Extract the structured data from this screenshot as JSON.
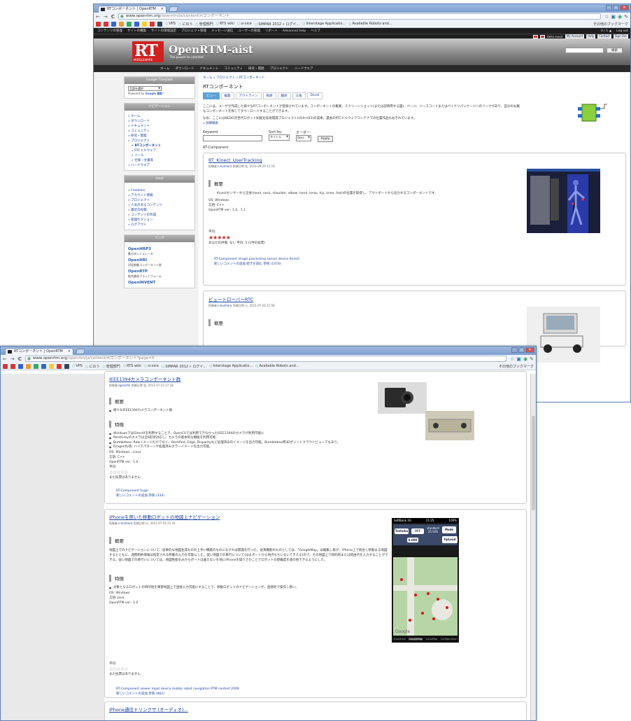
{
  "window1": {
    "tab_title": "RTコンポーネント | OpenRTM",
    "tab_close": "×",
    "controls": [
      "–",
      "▫",
      "✕"
    ],
    "url_host": "www.openrtm.org",
    "url_path": "/openrtm/ja/content/rtコンポーネント",
    "nav_back": "←",
    "nav_forward": "→",
    "nav_reload": "C",
    "bookmarks": [
      "VPS",
      "にのう",
      "管理部門",
      "RTS wiki",
      "si-sice",
      "SIMPAR 2012 » ログイ...",
      "Interstage Applicatio...",
      "Available Robots and..."
    ],
    "bookmarks_other": "その他のブックマーク",
    "admin_menu": [
      "コンテンツの管理",
      "サイトの構築",
      "サイトの環境設定",
      "プロジェクト管理",
      "メッセージ送信",
      "ユーザーの管理",
      "リポート",
      "Advanced help",
      "ヘルプ"
    ],
    "admin_count": "0 / 1 ▲",
    "admin_logout": "Log out",
    "user_links": [
      "Hello mostr",
      "My Account",
      "Help",
      "Contact",
      "Sign Out"
    ],
    "site_title": "OpenRTM-aist",
    "site_subtitle": "The power to connect",
    "logo_text": "RT",
    "logo_sub": "MIDDLEWARE",
    "search_button": "検索",
    "nav_items": [
      "ホーム",
      "ダウンロード",
      "ドキュメント",
      "コミュニティ",
      "研究・開発",
      "プロジェクト",
      "ハードウエア"
    ],
    "sidebar": {
      "translate_title": "Google Translate",
      "translate_select": "言語を選択",
      "powered_by": "Powered by",
      "powered_brand": "Google 翻訳",
      "nav_title": "ナビゲーション",
      "nav_links": [
        "» ホーム",
        "» ダウンロード",
        "» ドキュメント",
        "» コミュニティ",
        "» 研究・開発",
        "» プロジェクト",
        "» RTコンポーネント",
        "» RTCドルウェア",
        "» ツール",
        "» 仕様・文書等",
        "» ハードウエア"
      ],
      "user_title": "most",
      "user_links": [
        "» Freelinks",
        "» アカウント情報",
        "» プロジェクト",
        "» 人気のあるコンテンツ",
        "» 最近の投稿",
        "» コンテンツの作成",
        "» 管理セクション",
        "» ログアウト"
      ],
      "links_title": "リンク",
      "ext_links": [
        {
          "name": "OpenHRP3",
          "desc": "動力学シミュレータ"
        },
        {
          "name": "OpenHRI",
          "desc": "対話制御コンポーネント群"
        },
        {
          "name": "OpenRTP",
          "desc": "統合開発プラットフォーム"
        },
        {
          "name": "OpenINVENT",
          "desc": ""
        }
      ]
    },
    "breadcrumb": "ホーム » プロジェクト » RTコンポーネント",
    "page_title": "RTコンポーネント",
    "page_tabs": [
      "ビュー",
      "編集",
      "アウトライン",
      "軌跡",
      "翻訳",
      "三角",
      "Devel"
    ],
    "desc1": "ここには、ユーザが作成した様々なRTコンポーネントが登録されています。コンポーネントの概要、スクリーンショット(または説明用する図)、ページ、ソースコードまたはバイナリパッケージへのリンクがあり、自分のお菓なコンポーネントを探してダウンロードすることができます。",
    "desc2": "なお、ここにはNEDO次世代ロボット知能化技術開発プロジェクト(H19-H23)の成果、還会のRTCドルウェアコンテナ下の位置作品もおきれています。",
    "more_link": "» 詳細検索",
    "filter": {
      "keyword_label": "Keyword",
      "sort_label": "Sort by:",
      "sort_value": "タイトル",
      "order_label": "オーダー:",
      "order_value": "Desc",
      "apply": "Apply"
    },
    "list_label": "RT-Component",
    "card1": {
      "title": "RT_Kinect_UserTracking",
      "meta_prefix": "投稿者:",
      "author": "s-kurihara",
      "meta_suffix": "投稿日時:金, 2011-09-29 11:19",
      "section": "概要",
      "body": "Kinectセンサーから全身(head, neck, shoulder, elbow, hand, torso, hip, knee, foot)の位置を取得し、アウトポートから出力するコンポーネントです。",
      "os": "OS: Windows",
      "lang": "言語: C++",
      "ver": "OpenRTM ver.: 1.0、1.1",
      "rating_label": "平均:",
      "stars": "★★★★★",
      "rating_text": "あなたの評価: なし 平均: 5 (1件の投票)",
      "tags": "RT-Component  image processing  sensor device  Kinect",
      "links": "新しいコメントの追加  続きを読む  参照 (1474)"
    },
    "card2": {
      "title": "ビュートローバーRTC",
      "meta_prefix": "投稿者:",
      "author": "s-kurihara",
      "meta_suffix": "投稿日時:火, 2011-07-26 21:58",
      "section": "概要"
    }
  },
  "window2": {
    "tab_title": "RTコンポーネント | OpenRTM",
    "tab_close": "×",
    "controls": [
      "–",
      "▫",
      "✕"
    ],
    "url_host": "www.openrtm.org",
    "url_path": "/openrtm/ja/content/rtコンポーネント?page=5",
    "nav_back": "←",
    "nav_forward": "→",
    "nav_reload": "C",
    "bookmarks": [
      "VPS",
      "にのう",
      "管理部門",
      "RTS wiki",
      "si-sice",
      "SIMPAR 2012 » ログイ...",
      "Interstage Applicatio...",
      "Available Robots and..."
    ],
    "bookmarks_other": "その他のブックマーク",
    "cardA": {
      "title": "IEEE1394カメラコンポーネント群",
      "meta_prefix": "投稿者:",
      "author": "openrtm",
      "meta_suffix": "投稿日時:金, 2011-07-15 17:18",
      "overview": "概要",
      "overview_items": [
        "様々なIEEE1394カメラコンポーネント群"
      ],
      "features": "特徴",
      "feature_items": [
        "WindowsではDirectXを利用することで、OpenCVでは利用できなかったIEEE1394のカメラが利用可能に",
        "PointGreyのカメラは全6形状対応し、カメラの基本的な機能を利用可能",
        "Bumblebee: Rawイメージだけでなく、Rectified, Edge, Disparityなど処理済みのイメージを出力可能。Bumblebee用3Dポイントクラウドビューアもあり。",
        "Dragonfly等: ハイアパターンや処理済みカラーイメージを出力可能。"
      ],
      "os": "OS: Windows , Linux",
      "lang": "言語: C++",
      "ver": "OpenRTM ver.: 1.0",
      "rating_label": "平均:",
      "stars": "☆☆☆☆☆",
      "rating_text": "まだ投票はありません",
      "tags": "RT-Component  huge",
      "links": "新しいコメントの追加  参照 (334)"
    },
    "cardB": {
      "title": "iPhoneを用いた移動ロボットの地図上ナビゲーション",
      "meta_prefix": "投稿者:",
      "author": "s-kurihara",
      "meta_suffix": "投稿日時:火, 2011-07-26 21:34",
      "overview": "概要",
      "body": "地図上でのナビゲーションについて、従来的な地図生成ものの上手い機能のものになければ開発を行った。従来機能のものとしては、「GoogleMap」は編集し易が、iPhone上で統合し移動まる地図するとともに、連携制約情報は指定される移動の入力を可能にした。従い地図での目行について(はまポートから地点もちいるいてきえる)ので、その地図上で目的地または経由点を入力することができる。従い地図での目行いについては、地図性能をみからポートは違えないを地にiPhoneを操りさかことでロボットの距離度を放の地できるようにした。",
      "features": "特徴",
      "feature_items": [
        "対象となるロボットの目的地を障害地図上で直接入力可能にすることで、移動ロボットのナビゲーションが、直感的で操作し易い。"
      ],
      "os": "OS: Windows",
      "lang": "言語: Java",
      "ver": "OpenRTM ver.: 1.0",
      "rating_label": "平均:",
      "stars": "☆☆☆☆☆",
      "rating_text": "まだ投票はありません",
      "tags": "RT-Component  viewer  input device  mobile robot  navigation  RTM contest 2009",
      "links": "新しいコメントの追加  参照 (862)"
    },
    "cardC_title": "iPhone通信ドリンクサ (オーディオ)...",
    "phone": {
      "carrier": "SoftBank 3G",
      "time": "21:25",
      "battery": "100%",
      "toshoku": "Toshoku",
      "off": "OFF",
      "standard": "standard",
      "standard_val": "25.926",
      "mode": "Mode",
      "val": "0.000",
      "upload": "UpLoad",
      "google": "Google",
      "tabs": [
        "AutoDrive",
        "GoogleMap",
        "LocalMap",
        "Configuration"
      ]
    }
  }
}
